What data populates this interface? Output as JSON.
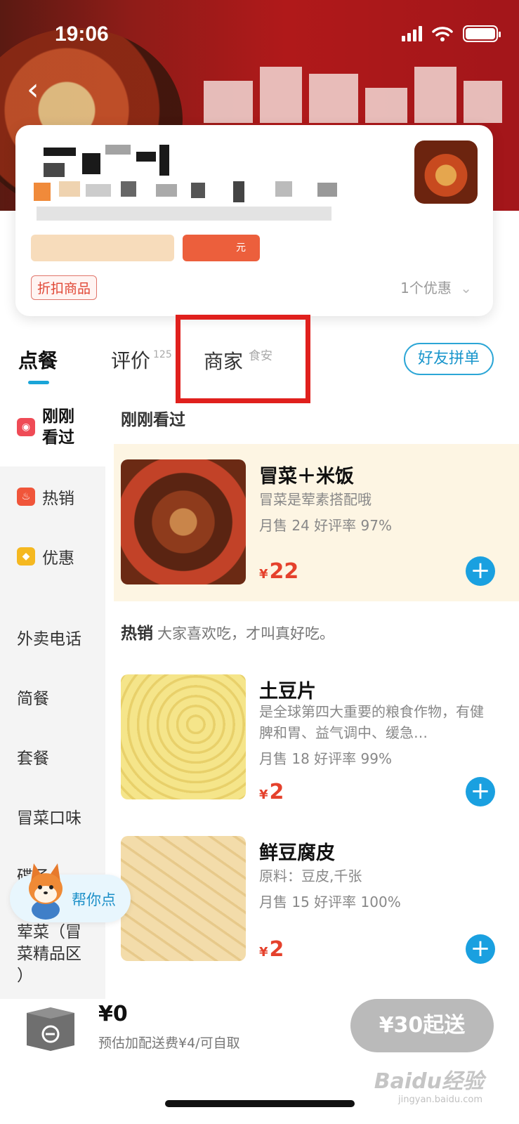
{
  "status_bar": {
    "time": "19:06"
  },
  "store": {
    "discount_tag": "折扣商品",
    "coupon_text": "1个优惠",
    "coupon_unit": "元"
  },
  "tabs": {
    "order": "点餐",
    "review": "评价",
    "review_count": "125",
    "merchant": "商家",
    "merchant_badge": "食安",
    "group_order": "好友拼单"
  },
  "sidebar": {
    "items": [
      {
        "label": "刚刚\n看过",
        "icon": "eye-icon"
      },
      {
        "label": "热销",
        "icon": "fire-icon"
      },
      {
        "label": "优惠",
        "icon": "tag-icon"
      },
      {
        "label": "外卖电话"
      },
      {
        "label": "简餐"
      },
      {
        "label": "套餐"
      },
      {
        "label": "冒菜口味"
      },
      {
        "label": "碟子"
      },
      {
        "label": "荤菜（冒\n菜精品区\n）"
      }
    ]
  },
  "sections": {
    "recent_title": "刚刚看过",
    "hot_title": "热销",
    "hot_subtitle": "大家喜欢吃，才叫真好吃。"
  },
  "items": [
    {
      "name": "冒菜＋米饭",
      "desc": "冒菜是荤素搭配哦",
      "sales": "月售 24   好评率 97%",
      "currency": "¥",
      "price": "22"
    },
    {
      "name": "土豆片",
      "desc": "是全球第四大重要的粮食作物，有健脾和胃、益气调中、缓急…",
      "sales": "月售 18   好评率 99%",
      "currency": "¥",
      "price": "2"
    },
    {
      "name": "鲜豆腐皮",
      "desc": "原料：豆皮,千张",
      "sales": "月售 15   好评率 100%",
      "currency": "¥",
      "price": "2"
    }
  ],
  "helper": {
    "label": "帮你点"
  },
  "bottom": {
    "total": "¥0",
    "fee_text": "预估加配送费¥4/可自取",
    "min_order": "¥30起送"
  },
  "watermark": {
    "brand": "Baidu经验",
    "sub": "jingyan.baidu.com"
  },
  "colors": {
    "accent": "#1aa0e0",
    "price": "#e5412c",
    "highlight_box": "#e0201d",
    "banner": "#b0191a"
  }
}
